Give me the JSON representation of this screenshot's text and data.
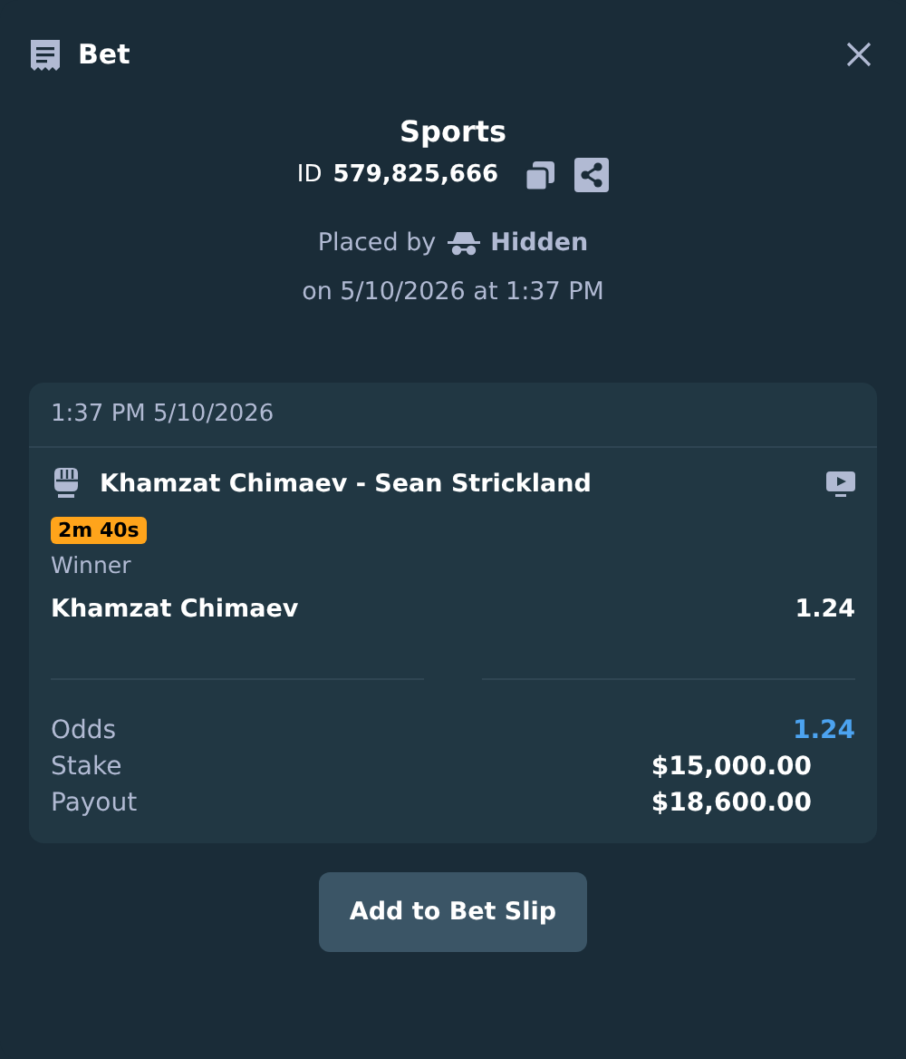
{
  "header": {
    "title": "Bet"
  },
  "summary": {
    "category": "Sports",
    "id_label": "ID",
    "id_value": "579,825,666",
    "placed_by_label": "Placed by",
    "placed_by_user": "Hidden",
    "placed_on": "on 5/10/2026 at 1:37 PM"
  },
  "card": {
    "timestamp": "1:37 PM 5/10/2026",
    "event": "Khamzat Chimaev - Sean Strickland",
    "timer_badge": "2m 40s",
    "market": "Winner",
    "selection": "Khamzat Chimaev",
    "selection_odds": "1.24",
    "totals": [
      {
        "kind": "odds",
        "label": "Odds",
        "value": "1.24"
      },
      {
        "kind": "amount",
        "label": "Stake",
        "value": "$15,000.00"
      },
      {
        "kind": "amount",
        "label": "Payout",
        "value": "$18,600.00"
      }
    ]
  },
  "button": "Add to Bet Slip"
}
